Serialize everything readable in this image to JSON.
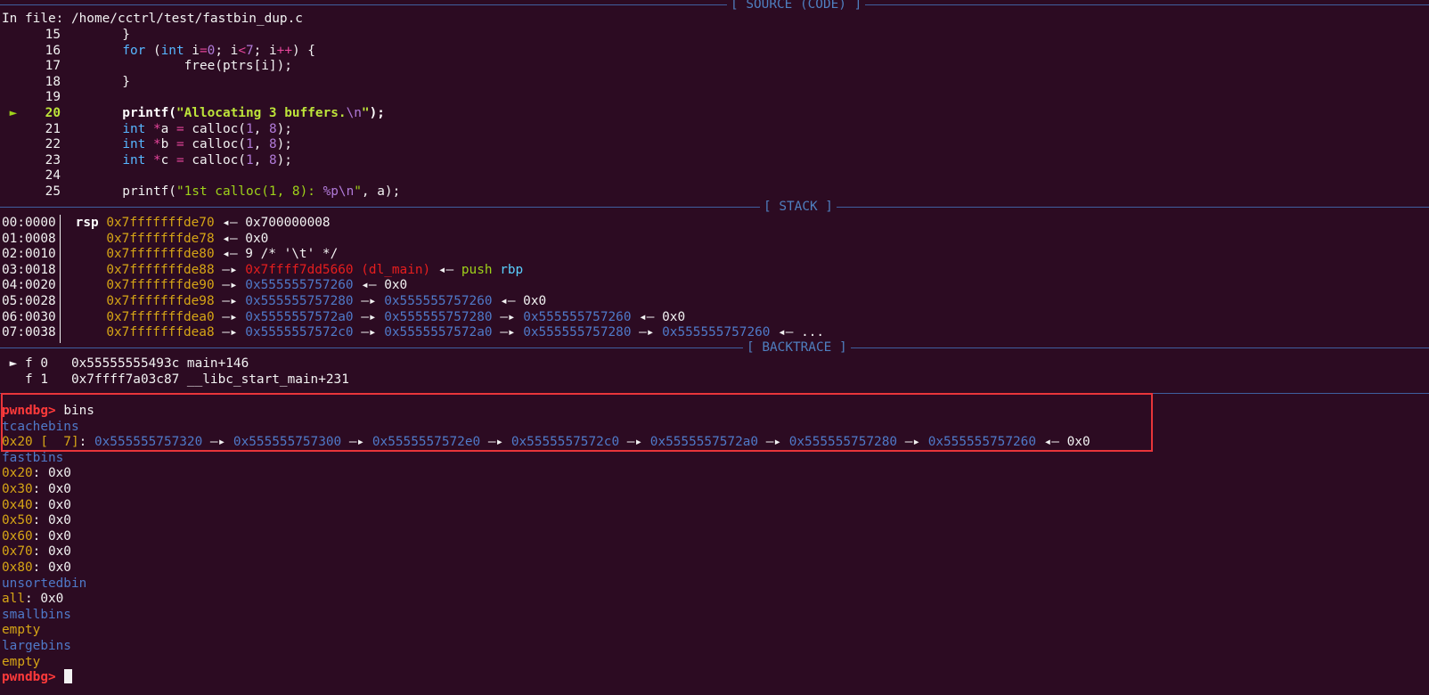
{
  "source": {
    "header_title": "[ SOURCE (CODE) ]",
    "file_label": "In file: /home/cctrl/test/fastbin_dup.c",
    "lines": [
      {
        "no": "15",
        "parts": [
          [
            "w",
            "        }"
          ]
        ]
      },
      {
        "no": "16",
        "parts": [
          [
            "w",
            "        "
          ],
          [
            "lb",
            "for"
          ],
          [
            "w",
            " ("
          ],
          [
            "lb",
            "int"
          ],
          [
            "w",
            " i"
          ],
          [
            "m",
            "="
          ],
          [
            "p",
            "0"
          ],
          [
            "w",
            "; i"
          ],
          [
            "m",
            "<"
          ],
          [
            "p",
            "7"
          ],
          [
            "w",
            "; i"
          ],
          [
            "m",
            "++"
          ],
          [
            "w",
            ") {"
          ]
        ]
      },
      {
        "no": "17",
        "parts": [
          [
            "w",
            "                free(ptrs[i]);"
          ]
        ]
      },
      {
        "no": "18",
        "parts": [
          [
            "w",
            "        }"
          ]
        ]
      },
      {
        "no": "19",
        "parts": []
      },
      {
        "no": "20",
        "current": true,
        "parts": [
          [
            "bw",
            "        printf("
          ],
          [
            "gb",
            "\"Allocating 3 buffers."
          ],
          [
            "p",
            "\\n"
          ],
          [
            "gb",
            "\""
          ],
          [
            "bw",
            ");"
          ]
        ]
      },
      {
        "no": "21",
        "parts": [
          [
            "w",
            "        "
          ],
          [
            "lb",
            "int"
          ],
          [
            "w",
            " "
          ],
          [
            "m",
            "*"
          ],
          [
            "w",
            "a "
          ],
          [
            "m",
            "="
          ],
          [
            "w",
            " calloc("
          ],
          [
            "p",
            "1"
          ],
          [
            "w",
            ", "
          ],
          [
            "p",
            "8"
          ],
          [
            "w",
            ");"
          ]
        ]
      },
      {
        "no": "22",
        "parts": [
          [
            "w",
            "        "
          ],
          [
            "lb",
            "int"
          ],
          [
            "w",
            " "
          ],
          [
            "m",
            "*"
          ],
          [
            "w",
            "b "
          ],
          [
            "m",
            "="
          ],
          [
            "w",
            " calloc("
          ],
          [
            "p",
            "1"
          ],
          [
            "w",
            ", "
          ],
          [
            "p",
            "8"
          ],
          [
            "w",
            ");"
          ]
        ]
      },
      {
        "no": "23",
        "parts": [
          [
            "w",
            "        "
          ],
          [
            "lb",
            "int"
          ],
          [
            "w",
            " "
          ],
          [
            "m",
            "*"
          ],
          [
            "w",
            "c "
          ],
          [
            "m",
            "="
          ],
          [
            "w",
            " calloc("
          ],
          [
            "p",
            "1"
          ],
          [
            "w",
            ", "
          ],
          [
            "p",
            "8"
          ],
          [
            "w",
            ");"
          ]
        ]
      },
      {
        "no": "24",
        "parts": []
      },
      {
        "no": "25",
        "parts": [
          [
            "w",
            "        printf("
          ],
          [
            "g",
            "\"1st calloc(1, 8): "
          ],
          [
            "p",
            "%p\\n"
          ],
          [
            "g",
            "\""
          ],
          [
            "w",
            ", a);"
          ]
        ]
      }
    ]
  },
  "stack": {
    "header_title": "[ STACK ]",
    "rows": [
      {
        "off": "00:0000",
        "parts": [
          [
            "bw",
            " rsp "
          ],
          [
            "y",
            "0x7fffffffde70"
          ],
          [
            "w",
            " ◂— 0x700000008"
          ]
        ]
      },
      {
        "off": "01:0008",
        "parts": [
          [
            "w",
            "     "
          ],
          [
            "y",
            "0x7fffffffde78"
          ],
          [
            "w",
            " ◂— 0x0"
          ]
        ]
      },
      {
        "off": "02:0010",
        "parts": [
          [
            "w",
            "     "
          ],
          [
            "y",
            "0x7fffffffde80"
          ],
          [
            "w",
            " ◂— 9 /* '\\t' */"
          ]
        ]
      },
      {
        "off": "03:0018",
        "parts": [
          [
            "w",
            "     "
          ],
          [
            "y",
            "0x7fffffffde88"
          ],
          [
            "w",
            " —▸ "
          ],
          [
            "r",
            "0x7ffff7dd5660 (dl_main)"
          ],
          [
            "w",
            " ◂— "
          ],
          [
            "g",
            "push"
          ],
          [
            "w",
            " "
          ],
          [
            "cy",
            "rbp"
          ]
        ]
      },
      {
        "off": "04:0020",
        "parts": [
          [
            "w",
            "     "
          ],
          [
            "y",
            "0x7fffffffde90"
          ],
          [
            "w",
            " —▸ "
          ],
          [
            "b",
            "0x555555757260"
          ],
          [
            "w",
            " ◂— 0x0"
          ]
        ]
      },
      {
        "off": "05:0028",
        "parts": [
          [
            "w",
            "     "
          ],
          [
            "y",
            "0x7fffffffde98"
          ],
          [
            "w",
            " —▸ "
          ],
          [
            "b",
            "0x555555757280"
          ],
          [
            "w",
            " —▸ "
          ],
          [
            "b",
            "0x555555757260"
          ],
          [
            "w",
            " ◂— 0x0"
          ]
        ]
      },
      {
        "off": "06:0030",
        "parts": [
          [
            "w",
            "     "
          ],
          [
            "y",
            "0x7fffffffdea0"
          ],
          [
            "w",
            " —▸ "
          ],
          [
            "b",
            "0x5555557572a0"
          ],
          [
            "w",
            " —▸ "
          ],
          [
            "b",
            "0x555555757280"
          ],
          [
            "w",
            " —▸ "
          ],
          [
            "b",
            "0x555555757260"
          ],
          [
            "w",
            " ◂— 0x0"
          ]
        ]
      },
      {
        "off": "07:0038",
        "parts": [
          [
            "w",
            "     "
          ],
          [
            "y",
            "0x7fffffffdea8"
          ],
          [
            "w",
            " —▸ "
          ],
          [
            "b",
            "0x5555557572c0"
          ],
          [
            "w",
            " —▸ "
          ],
          [
            "b",
            "0x5555557572a0"
          ],
          [
            "w",
            " —▸ "
          ],
          [
            "b",
            "0x555555757280"
          ],
          [
            "w",
            " —▸ "
          ],
          [
            "b",
            "0x555555757260"
          ],
          [
            "w",
            " ◂— ..."
          ]
        ]
      }
    ]
  },
  "backtrace": {
    "header_title": "[ BACKTRACE ]",
    "frames": [
      {
        "marker": " ►",
        "text": " f 0   0x55555555493c main+146"
      },
      {
        "marker": "  ",
        "text": " f 1   0x7ffff7a03c87 __libc_start_main+231"
      }
    ]
  },
  "terminal": {
    "lines": [
      [
        [
          "rb",
          "pwndbg> "
        ],
        [
          "w",
          "bins"
        ]
      ],
      [
        [
          "b",
          "tcachebins"
        ]
      ],
      [
        [
          "y",
          "0x20 [  7]"
        ],
        [
          "w",
          ": "
        ],
        [
          "b",
          "0x555555757320"
        ],
        [
          "w",
          " —▸ "
        ],
        [
          "b",
          "0x555555757300"
        ],
        [
          "w",
          " —▸ "
        ],
        [
          "b",
          "0x5555557572e0"
        ],
        [
          "w",
          " —▸ "
        ],
        [
          "b",
          "0x5555557572c0"
        ],
        [
          "w",
          " —▸ "
        ],
        [
          "b",
          "0x5555557572a0"
        ],
        [
          "w",
          " —▸ "
        ],
        [
          "b",
          "0x555555757280"
        ],
        [
          "w",
          " —▸ "
        ],
        [
          "b",
          "0x555555757260"
        ],
        [
          "w",
          " ◂— 0x0"
        ]
      ],
      [
        [
          "b",
          "fastbins"
        ]
      ],
      [
        [
          "y",
          "0x20"
        ],
        [
          "w",
          ": 0x0"
        ]
      ],
      [
        [
          "y",
          "0x30"
        ],
        [
          "w",
          ": 0x0"
        ]
      ],
      [
        [
          "y",
          "0x40"
        ],
        [
          "w",
          ": 0x0"
        ]
      ],
      [
        [
          "y",
          "0x50"
        ],
        [
          "w",
          ": 0x0"
        ]
      ],
      [
        [
          "y",
          "0x60"
        ],
        [
          "w",
          ": 0x0"
        ]
      ],
      [
        [
          "y",
          "0x70"
        ],
        [
          "w",
          ": 0x0"
        ]
      ],
      [
        [
          "y",
          "0x80"
        ],
        [
          "w",
          ": 0x0"
        ]
      ],
      [
        [
          "b",
          "unsortedbin"
        ]
      ],
      [
        [
          "y",
          "all"
        ],
        [
          "w",
          ": 0x0"
        ]
      ],
      [
        [
          "b",
          "smallbins"
        ]
      ],
      [
        [
          "y",
          "empty"
        ]
      ],
      [
        [
          "b",
          "largebins"
        ]
      ],
      [
        [
          "y",
          "empty"
        ]
      ],
      [
        [
          "rb",
          "pwndbg> "
        ]
      ]
    ]
  }
}
